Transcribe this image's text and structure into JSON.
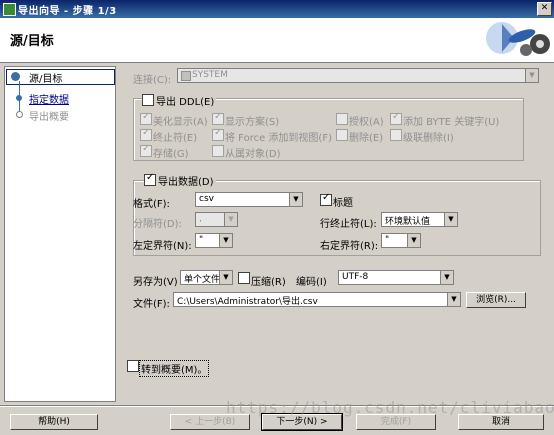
{
  "window": {
    "title": "导出向导 - 步骤 1/3"
  },
  "header": {
    "title": "源/目标"
  },
  "nav": {
    "items": [
      {
        "label": "源/目标"
      },
      {
        "label": "指定数据"
      },
      {
        "label": "导出概要"
      }
    ]
  },
  "connection": {
    "label": "连接(C):",
    "value": "SYSTEM"
  },
  "ddl": {
    "label": "导出 DDL(E)",
    "checked": false,
    "options": [
      {
        "label": "美化显示(A)",
        "checked": true
      },
      {
        "label": "显示方案(S)",
        "checked": true
      },
      {
        "label": "授权(A)",
        "checked": false
      },
      {
        "label": "添加 BYTE 关键字(U)",
        "checked": true
      },
      {
        "label": "终止符(E)",
        "checked": true
      },
      {
        "label": "将 Force 添加到视图(F)",
        "checked": true
      },
      {
        "label": "删除(E)",
        "checked": false
      },
      {
        "label": "级联删除(I)",
        "checked": false
      },
      {
        "label": "存储(G)",
        "checked": true
      },
      {
        "label": "从属对象(D)",
        "checked": false
      }
    ]
  },
  "export_data": {
    "label": "导出数据(D)",
    "checked": true,
    "format_label": "格式(F):",
    "format_value": "csv",
    "header_label": "标题",
    "header_checked": true,
    "delimiter_label": "分隔符(D):",
    "delimiter_value": ",",
    "line_terminator_label": "行终止符(L):",
    "line_terminator_value": "环境默认值",
    "left_enclosure_label": "左定界符(N):",
    "left_enclosure_value": "\"",
    "right_enclosure_label": "右定界符(R):",
    "right_enclosure_value": "\"",
    "save_as_label": "另存为(V)",
    "save_as_value": "单个文件",
    "compress_label": "压缩(R)",
    "compress_checked": false,
    "encoding_label": "编码(I)",
    "encoding_value": "UTF-8",
    "file_label": "文件(F):",
    "file_value": "C:\\Users\\Administrator\\导出.csv",
    "browse_label": "浏览(R)..."
  },
  "goto_summary": {
    "label": "转到概要(M)。",
    "checked": false
  },
  "buttons": {
    "help": "帮助(H)",
    "back": "< 上一步(B)",
    "next": "下一步(N) >",
    "finish": "完成(F)",
    "cancel": "取消"
  },
  "watermark": "https://blog.csdn.net/cliviabao",
  "colors": {
    "title_bar": "#0a246a",
    "dialog_bg": "#d4d0c8",
    "nav_accent": "#3a6ea5"
  }
}
